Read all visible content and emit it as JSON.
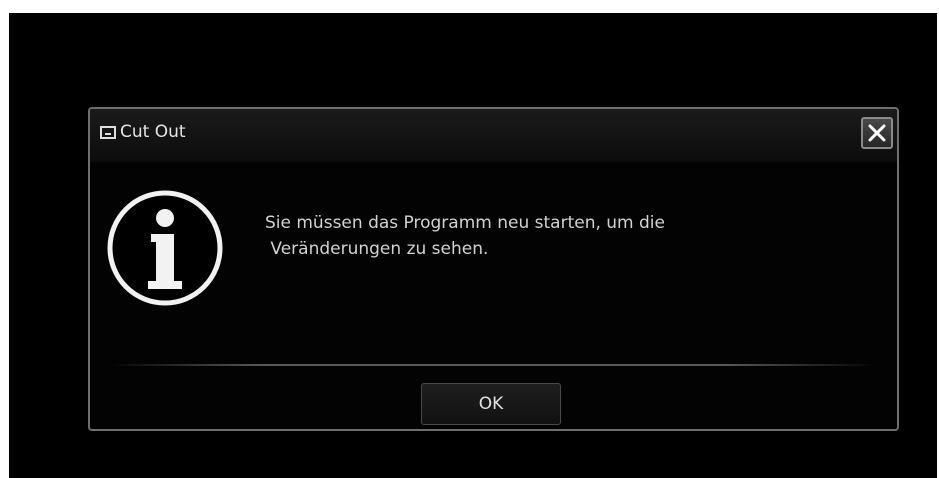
{
  "dialog": {
    "title": "Cut Out",
    "app_icon": "window-icon",
    "close_icon": "close-icon",
    "info_icon": "info-icon",
    "message_lines": [
      "Sie müssen das Programm neu starten, um die",
      " Veränderungen zu sehen."
    ],
    "ok_label": "OK"
  },
  "colors": {
    "background": "#000000",
    "border": "#6e6e6e",
    "text": "#d2d2d2"
  }
}
